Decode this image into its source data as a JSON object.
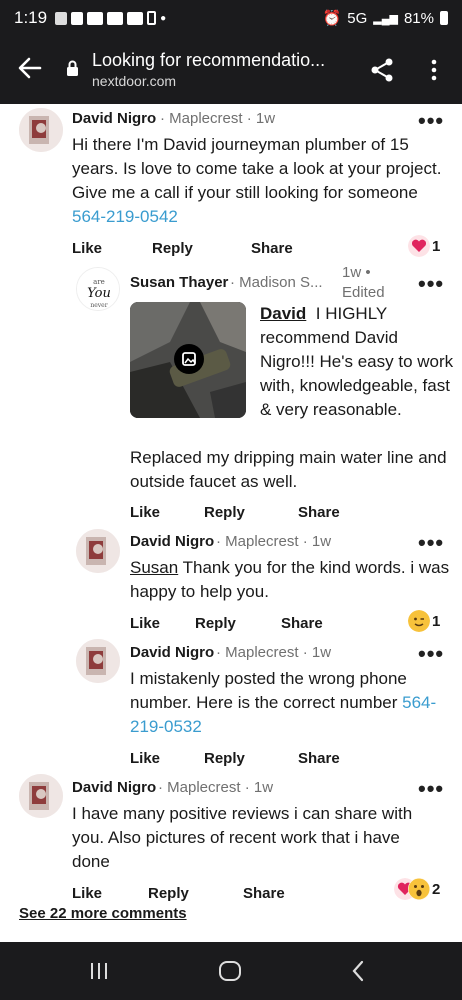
{
  "status": {
    "time": "1:19",
    "network": "5G",
    "battery": "81%"
  },
  "browser": {
    "title": "Looking for recommendatio...",
    "domain": "nextdoor.com"
  },
  "actions": {
    "like": "Like",
    "reply": "Reply",
    "share": "Share"
  },
  "comments": [
    {
      "author": "David Nigro",
      "meta": "· Maplecrest · 1w",
      "text_prefix": "Hi there I'm David journeyman plumber of 15 years. Is love to come take a look at your project. Give me a call if your still looking for someone ",
      "phone": "564-219-0542",
      "reaction_count": "1"
    },
    {
      "author": "Susan Thayer",
      "meta": "· Madison S...",
      "time": "1w •",
      "edited": "Edited",
      "mention": "David",
      "text_side": "I HIGHLY recommend David Nigro!!! He's easy to work with, knowledgeable, fast & very reasonable.",
      "text_below": "Replaced my dripping main water line and outside faucet as well."
    },
    {
      "author": "David Nigro",
      "meta": "· Maplecrest · 1w",
      "mention": "Susan",
      "text": " Thank you for the kind words. i was happy to help you.",
      "reaction_count": "1"
    },
    {
      "author": "David Nigro",
      "meta": "· Maplecrest · 1w",
      "text_prefix": "I mistakenly posted the wrong phone number. Here is the correct number ",
      "phone": "564-219-0532"
    },
    {
      "author": "David Nigro",
      "meta": "· Maplecrest · 1w",
      "text": "I have many positive reviews i can share with you. Also pictures of recent work that i have done",
      "reaction_count": "2"
    }
  ],
  "see_more": "See 22 more comments",
  "avatar_text": {
    "line1": "You",
    "line2": "are",
    "line3": "never"
  },
  "colors": {
    "link": "#3a9ccf",
    "chrome": "#1b1b1d",
    "heart": "#e0245e"
  }
}
